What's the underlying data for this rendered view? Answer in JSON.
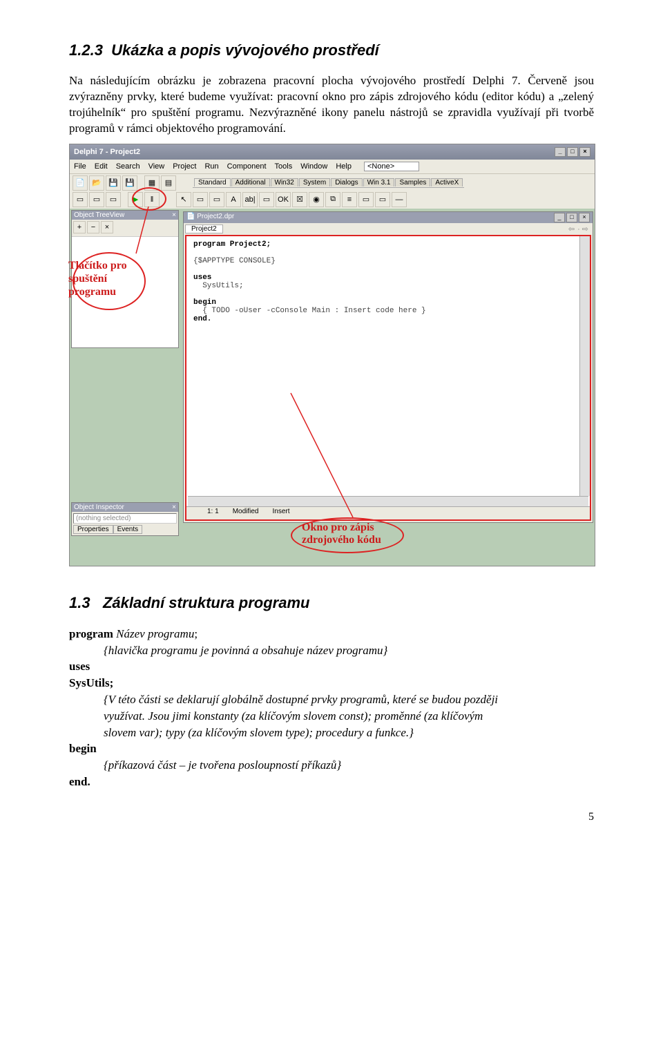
{
  "section123": {
    "num": "1.2.3",
    "title": "Ukázka a popis vývojového prostředí",
    "paragraph": "Na následujícím obrázku je zobrazena pracovní plocha vývojového prostředí Delphi 7. Červeně jsou zvýrazněny prvky, které budeme využívat: pracovní okno pro zápis zdrojového kódu (editor kódu) a „zelený trojúhelník“ pro spuštění programu. Nezvýrazněné ikony panelu nástrojů se zpravidla využívají při tvorbě programů v rámci objektového programování."
  },
  "ide": {
    "title": "Delphi 7 - Project2",
    "menus": [
      "File",
      "Edit",
      "Search",
      "View",
      "Project",
      "Run",
      "Component",
      "Tools",
      "Window",
      "Help"
    ],
    "none": "<None>",
    "palette_tabs": [
      "Standard",
      "Additional",
      "Win32",
      "System",
      "Dialogs",
      "Win 3.1",
      "Samples",
      "ActiveX"
    ],
    "treeview_title": "Object TreeView",
    "inspector_title": "Object Inspector",
    "inspector_selected": "(nothing selected)",
    "inspector_tabs": [
      "Properties",
      "Events"
    ],
    "editor_title": "Project2.dpr",
    "editor_tab": "Project2",
    "code_lines": [
      "program Project2;",
      "",
      "{$APPTYPE CONSOLE}",
      "",
      "uses",
      "  SysUtils;",
      "",
      "begin",
      "  { TODO -oUser -cConsole Main : Insert code here }",
      "end."
    ],
    "status_pos": "1: 1",
    "status_mod": "Modified",
    "status_ins": "Insert",
    "callouts": {
      "run_label_l1": "Tlačítko pro",
      "run_label_l2": "spuštění",
      "run_label_l3": "programu",
      "editor_label_l1": "Okno pro zápis",
      "editor_label_l2": "zdrojového kódu"
    }
  },
  "section13": {
    "num": "1.3",
    "title": "Základní struktura programu",
    "program_kw": "program",
    "program_name": "Název programu",
    "header_comment": "{hlavička programu je povinná a obsahuje název programu}",
    "uses_kw": "uses",
    "sysutils": "SysUtils;",
    "uses_comment_l1": "{V této části se deklarují globálně dostupné prvky programů, které se budou později",
    "uses_comment_l2": "využívat. Jsou jimi konstanty (za klíčovým slovem const); proměnné (za klíčovým",
    "uses_comment_l3": "slovem var); typy (za klíčovým slovem type); procedury a funkce.}",
    "begin_kw": "begin",
    "begin_comment": "{příkazová část – je tvořena posloupností příkazů}",
    "end_kw": "end."
  },
  "page_number": "5"
}
